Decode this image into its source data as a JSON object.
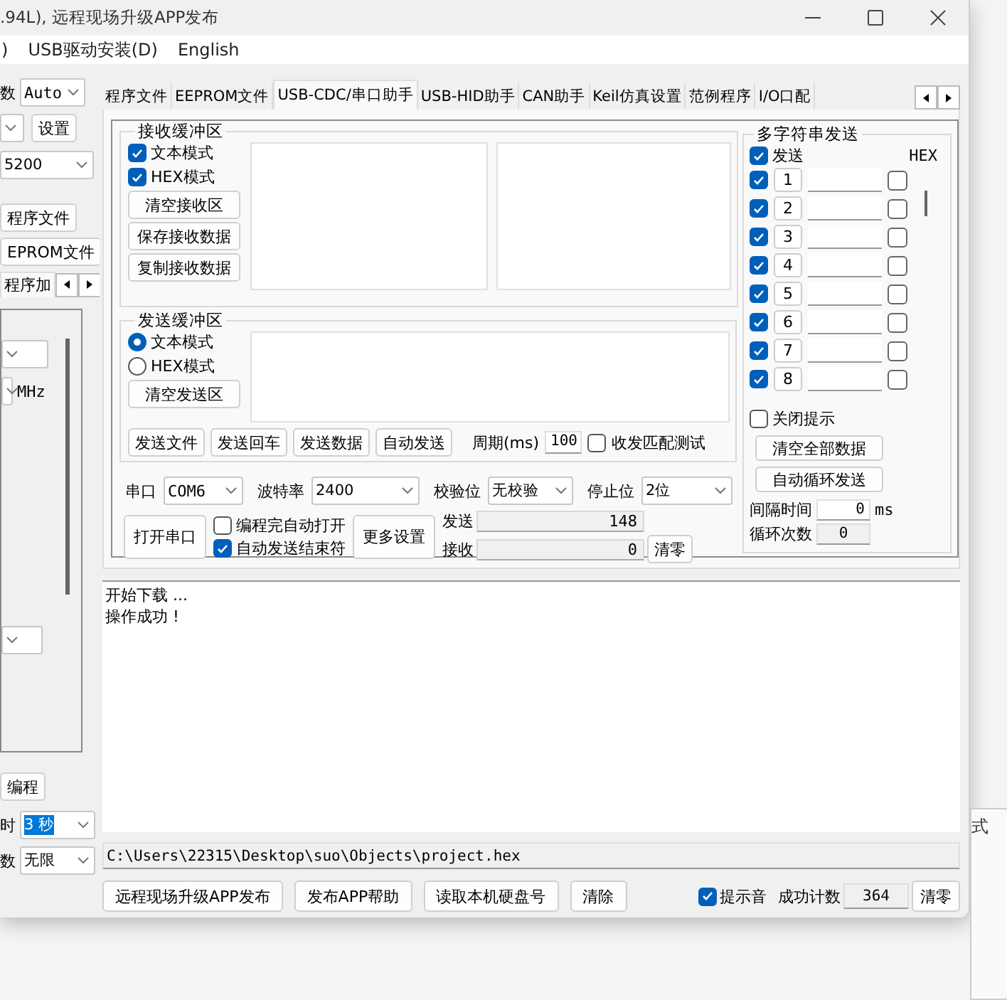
{
  "window": {
    "title": ".94L), 远程现场升级APP发布"
  },
  "menu": [
    {
      "label": ")"
    },
    {
      "label": "USB驱动安装(D)"
    },
    {
      "label": "English"
    }
  ],
  "left_panel": {
    "pins_label": "数",
    "pins_value": "Auto",
    "setup_button": "设置",
    "baud_value": "5200",
    "program_file_button": "程序文件",
    "eeprom_file_button": "EPROM文件",
    "subtab": "程序加",
    "freq_unit": "MHz",
    "program_button": "编程",
    "delay_label": "时",
    "delay_value": "3 秒",
    "repeat_label": "数",
    "repeat_value": "无限"
  },
  "tabs": [
    {
      "label": "程序文件",
      "selected": false
    },
    {
      "label": "EEPROM文件",
      "selected": false
    },
    {
      "label": "USB-CDC/串口助手",
      "selected": true
    },
    {
      "label": "USB-HID助手",
      "selected": false
    },
    {
      "label": "CAN助手",
      "selected": false
    },
    {
      "label": "Keil仿真设置",
      "selected": false
    },
    {
      "label": "范例程序",
      "selected": false
    },
    {
      "label": "I/O口配",
      "selected": false
    }
  ],
  "serial_tab": {
    "receive": {
      "title": "接收缓冲区",
      "modes": [
        {
          "label": "文本模式",
          "checked": true
        },
        {
          "label": "HEX模式",
          "checked": true
        }
      ],
      "buttons": [
        "清空接收区",
        "保存接收数据",
        "复制接收数据"
      ]
    },
    "send": {
      "title": "发送缓冲区",
      "modes": [
        {
          "label": "文本模式",
          "selected": true
        },
        {
          "label": "HEX模式",
          "selected": false
        }
      ],
      "clear_button": "清空发送区",
      "buttons": [
        "发送文件",
        "发送回车",
        "发送数据",
        "自动发送"
      ],
      "period_label": "周期(ms)",
      "period_value": "100",
      "match_test": {
        "label": "收发匹配测试",
        "checked": false
      }
    },
    "port_settings": [
      {
        "label": "串口",
        "value": "COM6"
      },
      {
        "label": "波特率",
        "value": "2400"
      },
      {
        "label": "校验位",
        "value": "无校验"
      },
      {
        "label": "停止位",
        "value": "2位"
      }
    ],
    "open_button": "打开串口",
    "options": [
      {
        "label": "编程完自动打开",
        "checked": false
      },
      {
        "label": "自动发送结束符",
        "checked": true
      }
    ],
    "more_button": "更多设置",
    "counters": [
      {
        "label": "发送",
        "value": "148"
      },
      {
        "label": "接收",
        "value": "0"
      }
    ],
    "reset_button": "清零",
    "multi": {
      "title": "多字符串发送",
      "send_all": {
        "label": "发送",
        "checked": true
      },
      "hex_label": "HEX",
      "rows": [
        {
          "number": "1",
          "checked": true,
          "hex": false
        },
        {
          "number": "2",
          "checked": true,
          "hex": false
        },
        {
          "number": "3",
          "checked": true,
          "hex": false
        },
        {
          "number": "4",
          "checked": true,
          "hex": false
        },
        {
          "number": "5",
          "checked": true,
          "hex": false
        },
        {
          "number": "6",
          "checked": true,
          "hex": false
        },
        {
          "number": "7",
          "checked": true,
          "hex": false
        },
        {
          "number": "8",
          "checked": true,
          "hex": false
        }
      ],
      "close_hint": {
        "label": "关闭提示",
        "checked": false
      },
      "buttons": [
        "清空全部数据",
        "自动循环发送"
      ],
      "interval_label": "间隔时间",
      "interval_value": "0",
      "interval_unit": "ms",
      "loop_label": "循环次数",
      "loop_value": "0"
    }
  },
  "log": [
    "开始下载 ...",
    "操作成功 !"
  ],
  "path": "C:\\Users\\22315\\Desktop\\suo\\Objects\\project.hex",
  "bottom": {
    "buttons": [
      "远程现场升级APP发布",
      "发布APP帮助",
      "读取本机硬盘号",
      "清除"
    ],
    "sound": {
      "label": "提示音",
      "checked": true
    },
    "count_label": "成功计数",
    "count_value": "364",
    "reset_button": "清零"
  },
  "background": {
    "partial_text": "式"
  }
}
